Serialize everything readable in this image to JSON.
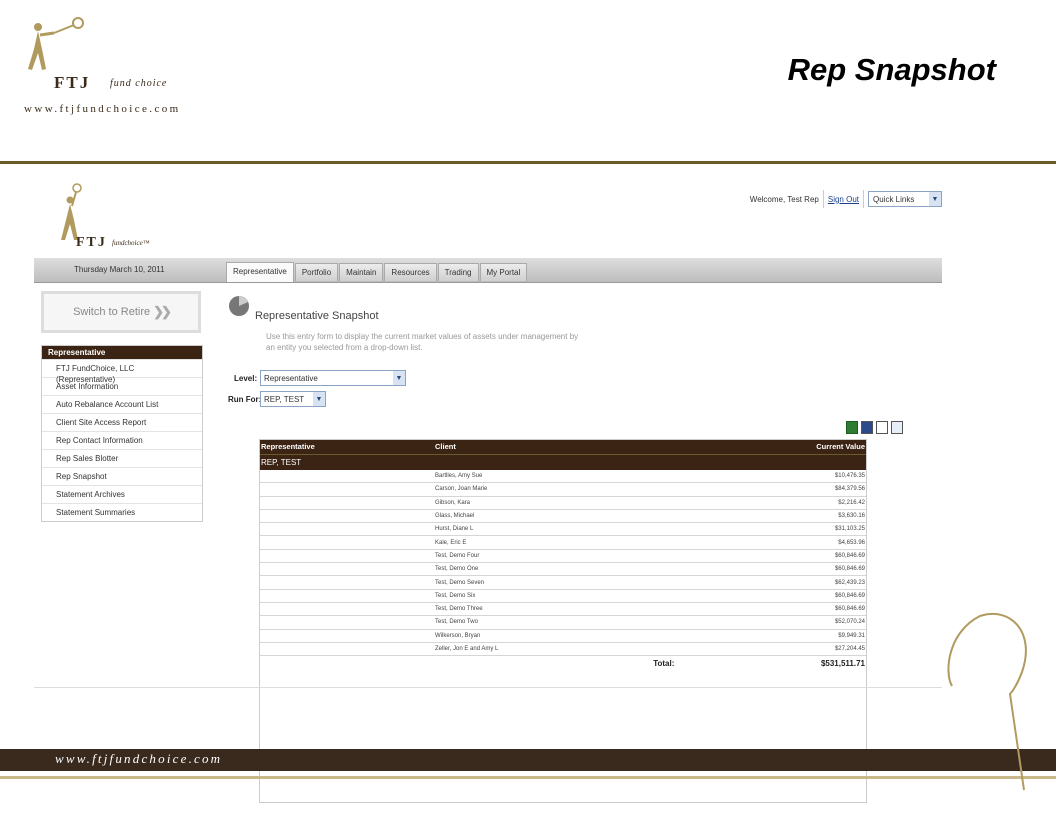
{
  "slide": {
    "title": "Rep Snapshot",
    "logo_brand": "FTJ",
    "logo_sub": "fund choice",
    "logo_url": "www.ftjfundchoice.com",
    "footer_url": "www.ftjfundchoice.com"
  },
  "app": {
    "logo_brand": "FTJ",
    "logo_sub": "fundchoice™",
    "welcome": "Welcome, Test Rep",
    "sign_out": "Sign Out",
    "quick_links": "Quick Links",
    "date": "Thursday March 10, 2011",
    "tabs": [
      {
        "label": "Representative",
        "active": true
      },
      {
        "label": "Portfolio"
      },
      {
        "label": "Maintain"
      },
      {
        "label": "Resources"
      },
      {
        "label": "Trading"
      },
      {
        "label": "My Portal"
      }
    ],
    "switch_label": "Switch to Retire",
    "menu": {
      "heading": "Representative",
      "items": [
        "FTJ FundChoice, LLC (Representative)",
        "Asset Information",
        "Auto Rebalance Account List",
        "Client Site Access Report",
        "Rep Contact Information",
        "Rep Sales Blotter",
        "Rep Snapshot",
        "Statement Archives",
        "Statement Summaries"
      ]
    },
    "main": {
      "title": "Representative Snapshot",
      "description": "Use this entry form to display the current market values of assets under management by an entity you selected from a drop-down list.",
      "level_label": "Level:",
      "level_value": "Representative",
      "run_for_label": "Run For:",
      "run_for_value": "REP, TEST"
    },
    "table": {
      "headers": [
        "Representative",
        "Client",
        "Current Value"
      ],
      "group": "REP, TEST",
      "rows": [
        {
          "client": "Bartlles, Amy Sue",
          "value": "$10,476.35"
        },
        {
          "client": "Carson, Joan Marie",
          "value": "$84,379.56"
        },
        {
          "client": "Gibson, Kara",
          "value": "$2,216.42"
        },
        {
          "client": "Glass, Michael",
          "value": "$3,630.16"
        },
        {
          "client": "Hurst, Diane L",
          "value": "$31,103.25"
        },
        {
          "client": "Kale, Eric E",
          "value": "$4,653.96"
        },
        {
          "client": "Test, Demo Four",
          "value": "$60,846.69"
        },
        {
          "client": "Test, Demo One",
          "value": "$60,846.69"
        },
        {
          "client": "Test, Demo Seven",
          "value": "$62,439.23"
        },
        {
          "client": "Test, Demo Six",
          "value": "$60,846.69"
        },
        {
          "client": "Test, Demo Three",
          "value": "$60,846.69"
        },
        {
          "client": "Test, Demo Two",
          "value": "$52,070.24"
        },
        {
          "client": "Wilkerson, Bryan",
          "value": "$9,949.31"
        },
        {
          "client": "Zeller, Jon E and Amy L",
          "value": "$27,204.45"
        }
      ],
      "total_label": "Total:",
      "total_value": "$531,511.71"
    }
  },
  "colors": {
    "dark_brown": "#3b2413",
    "gold_rule": "#6b5a2a",
    "link": "#1a3e8a"
  }
}
